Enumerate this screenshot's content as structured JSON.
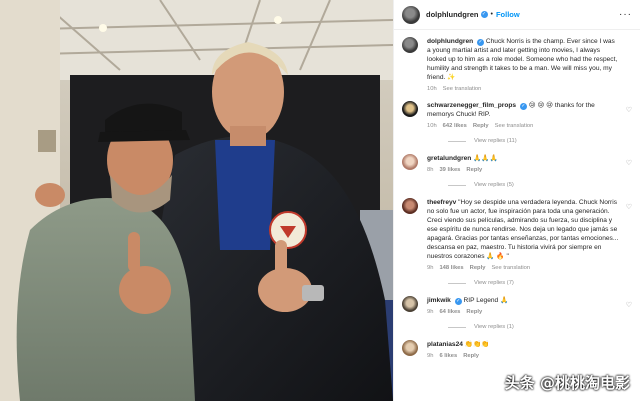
{
  "header": {
    "username": "dolphlundgren",
    "follow_label": "Follow",
    "separator": "•",
    "more_icon": "more-horizontal-icon"
  },
  "caption": {
    "username": "dolphlundgren",
    "text": "Chuck Norris is the champ. Ever since I was a young martial artist and later getting into movies, I always looked up to him as a role model. Someone who had the respect, humility and strength it takes to be a man. We will miss you, my friend. ✨",
    "time": "10h",
    "see_translation": "See translation"
  },
  "comments": [
    {
      "username": "schwarzenegger_film_props",
      "verified": true,
      "text": "😢 😢 😢 thanks for the memorys Chuck! RIP.",
      "time": "10h",
      "likes": "642 likes",
      "reply": "Reply",
      "see_translation": "See translation",
      "view_replies": "View replies (11)"
    },
    {
      "username": "gretalundgren",
      "verified": false,
      "text": "🙏🙏🙏",
      "time": "8h",
      "likes": "39 likes",
      "reply": "Reply",
      "view_replies": "View replies (5)"
    },
    {
      "username": "theefreyv",
      "verified": false,
      "text": "\"Hoy se despide una verdadera leyenda. Chuck Norris no solo fue un actor, fue inspiración para toda una generación. Creci viendo sus películas, admirando su fuerza, su disciplina y ese espíritu de nunca rendirse. Nos deja un legado que jamás se apagará. Gracias por tantas enseñanzas, por tantas emociones... descansa en paz, maestro. Tu historia vivirá por siempre en nuestros corazones 🙏 🔥 \"",
      "time": "9h",
      "likes": "148 likes",
      "reply": "Reply",
      "see_translation": "See translation",
      "view_replies": "View replies (7)"
    },
    {
      "username": "jimkwik",
      "verified": true,
      "text": "RIP Legend 🙏",
      "time": "9h",
      "likes": "64 likes",
      "reply": "Reply",
      "view_replies": "View replies (1)"
    },
    {
      "username": "platanias24",
      "verified": false,
      "text": "👏👏👏",
      "time": "9h",
      "likes": "6 likes",
      "reply": "Reply"
    }
  ],
  "watermark": "头条 @桃桃淘电影",
  "colors": {
    "accent": "#0095f6",
    "muted": "#8e8e8e",
    "text": "#262626",
    "verified": "#3897f0"
  }
}
